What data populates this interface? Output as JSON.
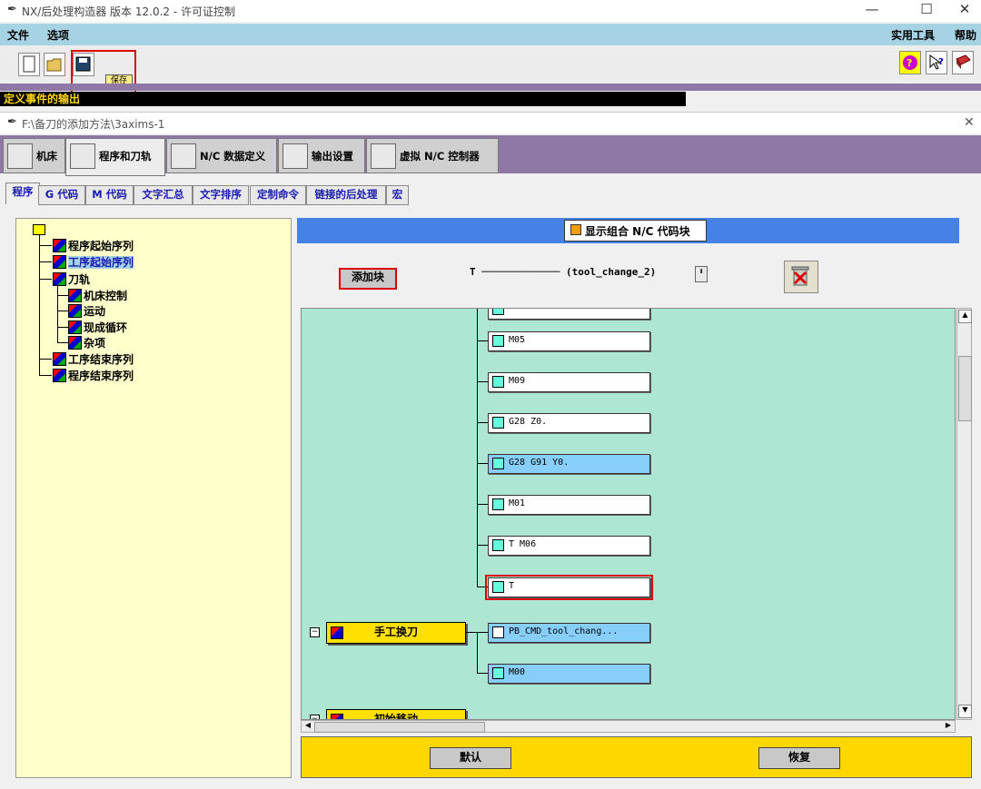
{
  "window": {
    "title": "NX/后处理构造器 版本 12.0.2 - 许可证控制",
    "minimize": "—",
    "maximize": "☐",
    "close": "✕"
  },
  "menu": {
    "file": "文件",
    "options": "选项",
    "utilities": "实用工具",
    "help": "帮助"
  },
  "toolbar": {
    "save_tooltip": "保存"
  },
  "status": "定义事件的输出",
  "subwindow": {
    "path": "F:\\备刀的添加方法\\3axims-1",
    "close": "✕"
  },
  "main_tabs": [
    "机床",
    "程序和刀轨",
    "N/C 数据定义",
    "输出设置",
    "虚拟 N/C 控制器"
  ],
  "sub_tabs": [
    "程序",
    "G 代码",
    "M 代码",
    "文字汇总",
    "文字排序",
    "定制命令",
    "链接的后处理",
    "宏"
  ],
  "tree": {
    "items": [
      "程序起始序列",
      "工序起始序列",
      "刀轨",
      "机床控制",
      "运动",
      "现成循环",
      "杂项",
      "工序结束序列",
      "程序结束序列"
    ]
  },
  "header": {
    "show_combined": "显示组合 N/C 代码块"
  },
  "controls": {
    "add_block": "添加块",
    "block_select": "T ───────────── (tool_change_2)",
    "dropdown_arrow": "⬇"
  },
  "blocks": [
    "M05",
    "M09",
    "G28 Z0.",
    "G28 G91 Y0.",
    "M01",
    "T M06",
    "T"
  ],
  "events": [
    {
      "label": "手工换刀",
      "blocks": [
        "PB_CMD_tool_chang...",
        "M00"
      ]
    },
    {
      "label": "初始移动",
      "blocks": []
    }
  ],
  "buttons": {
    "default": "默认",
    "restore": "恢复"
  },
  "colors": {
    "menubar": "#a6d3e3",
    "tabbar": "#8f78a6",
    "canvas": "#ade6d3",
    "event": "#ffe000",
    "highlight": "#dd0000"
  }
}
